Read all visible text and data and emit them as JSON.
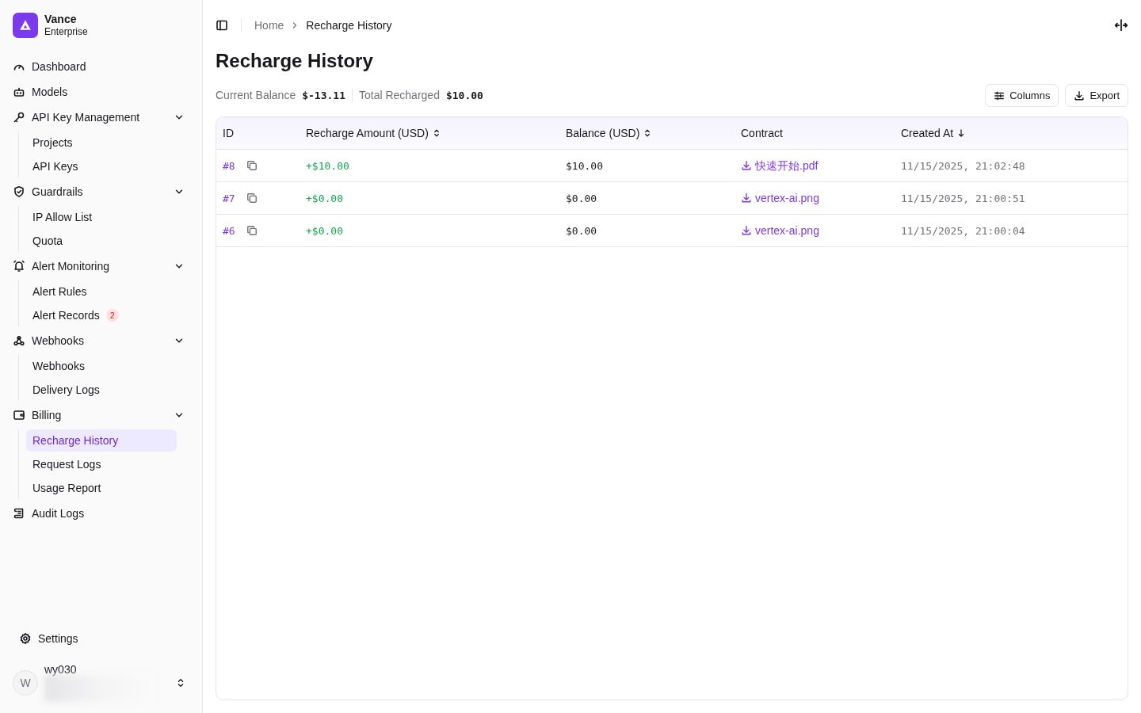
{
  "brand": {
    "name": "Vance",
    "subtitle": "Enterprise"
  },
  "sidebar": {
    "items": [
      {
        "kind": "link",
        "label": "Dashboard",
        "selected": false
      },
      {
        "kind": "link",
        "label": "Models",
        "selected": false
      },
      {
        "kind": "group",
        "label": "API Key Management",
        "expanded": true,
        "children": [
          {
            "label": "Projects",
            "selected": false
          },
          {
            "label": "API Keys",
            "selected": false
          }
        ]
      },
      {
        "kind": "group",
        "label": "Guardrails",
        "expanded": true,
        "children": [
          {
            "label": "IP Allow List",
            "selected": false
          },
          {
            "label": "Quota",
            "selected": false
          }
        ]
      },
      {
        "kind": "group",
        "label": "Alert Monitoring",
        "expanded": true,
        "children": [
          {
            "label": "Alert Rules",
            "selected": false
          },
          {
            "label": "Alert Records",
            "selected": false,
            "badge": "2"
          }
        ]
      },
      {
        "kind": "group",
        "label": "Webhooks",
        "expanded": true,
        "children": [
          {
            "label": "Webhooks",
            "selected": false
          },
          {
            "label": "Delivery Logs",
            "selected": false
          }
        ]
      },
      {
        "kind": "group",
        "label": "Billing",
        "expanded": true,
        "children": [
          {
            "label": "Recharge History",
            "selected": true
          },
          {
            "label": "Request Logs",
            "selected": false
          },
          {
            "label": "Usage Report",
            "selected": false
          }
        ]
      },
      {
        "kind": "link",
        "label": "Audit Logs",
        "selected": false
      }
    ],
    "settings": "Settings",
    "user": {
      "initial": "W",
      "name": "wy030"
    }
  },
  "breadcrumb": [
    "Home",
    "Recharge History"
  ],
  "page_title": "Recharge History",
  "summary": [
    {
      "label": "Current Balance",
      "value": "$-13.11"
    },
    {
      "label": "Total Recharged",
      "value": "$10.00"
    }
  ],
  "toolbar": [
    "Columns",
    "Export"
  ],
  "table": {
    "columns": [
      {
        "label": "ID",
        "sortable": false
      },
      {
        "label": "Recharge Amount (USD)",
        "sortable": true,
        "sorted": false
      },
      {
        "label": "Balance (USD)",
        "sortable": true,
        "sorted": false
      },
      {
        "label": "Contract",
        "sortable": false
      },
      {
        "label": "Created At",
        "sortable": true,
        "sorted": true
      }
    ],
    "rows": [
      {
        "id": "#8",
        "amount": "+$10.00",
        "balance": "$10.00",
        "contract": "快速开始.pdf",
        "created": "11/15/2025, 21:02:48"
      },
      {
        "id": "#7",
        "amount": "+$0.00",
        "balance": "$0.00",
        "contract": "vertex-ai.png",
        "created": "11/15/2025, 21:00:51"
      },
      {
        "id": "#6",
        "amount": "+$0.00",
        "balance": "$0.00",
        "contract": "vertex-ai.png",
        "created": "11/15/2025, 21:00:04"
      }
    ]
  }
}
